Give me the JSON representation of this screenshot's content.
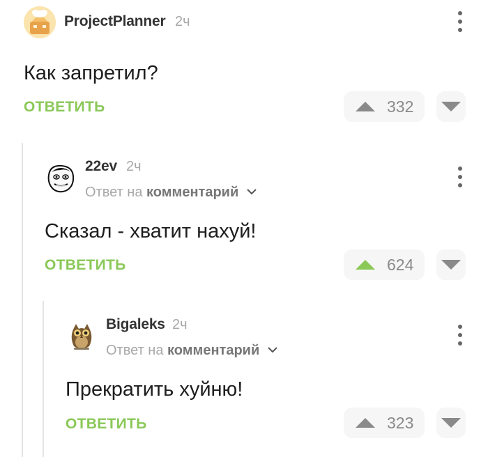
{
  "comments": [
    {
      "username": "ProjectPlanner",
      "time": "2ч",
      "text": "Как запретил?",
      "reply_label": "ОТВЕТИТЬ",
      "rating": "332",
      "upvoted": false
    },
    {
      "username": "22ev",
      "time": "2ч",
      "reply_to_prefix": "Ответ на",
      "reply_to_link": "комментарий",
      "text": "Сказал - хватит нахуй!",
      "reply_label": "ОТВЕТИТЬ",
      "rating": "624",
      "upvoted": true
    },
    {
      "username": "Bigaleks",
      "time": "2ч",
      "reply_to_prefix": "Ответ на",
      "reply_to_link": "комментарий",
      "text": "Прекратить хуйню!",
      "reply_label": "ОТВЕТИТЬ",
      "rating": "323",
      "upvoted": false
    }
  ],
  "colors": {
    "accent_green": "#8ac858",
    "upvote_active": "#8ac858",
    "vote_inactive": "#8a8a8a",
    "thread_line": "#e4e4e4"
  }
}
